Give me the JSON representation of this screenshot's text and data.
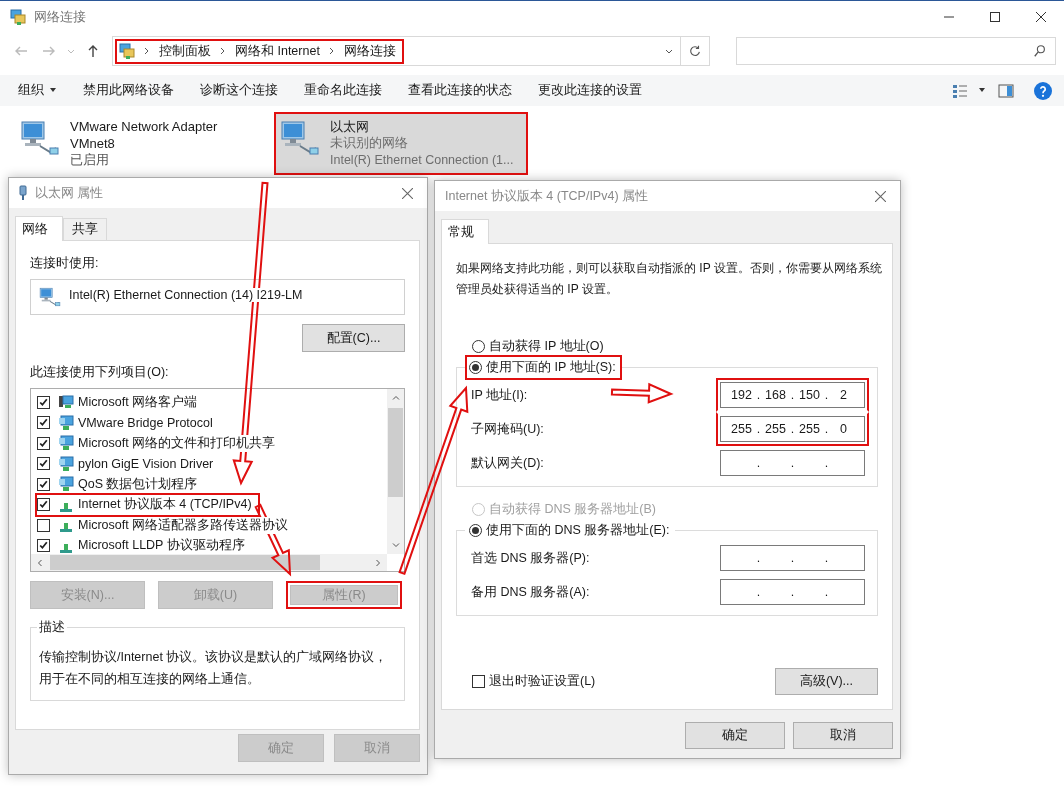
{
  "explorer": {
    "title": "网络连接",
    "breadcrumb": [
      {
        "label": "控制面板"
      },
      {
        "label": "网络和 Internet"
      },
      {
        "label": "网络连接"
      }
    ],
    "breadcrumb_highlighted": true,
    "toolbar": [
      {
        "label": "组织",
        "dropdown": true
      },
      {
        "label": "禁用此网络设备",
        "dropdown": false
      },
      {
        "label": "诊断这个连接",
        "dropdown": false
      },
      {
        "label": "重命名此连接",
        "dropdown": false
      },
      {
        "label": "查看此连接的状态",
        "dropdown": false
      },
      {
        "label": "更改此连接的设置",
        "dropdown": false
      }
    ],
    "connections": [
      {
        "name": "VMware Network Adapter VMnet8",
        "details": [
          "已启用"
        ],
        "selected": false,
        "highlighted": false
      },
      {
        "name": "以太网",
        "details": [
          "未识别的网络",
          "Intel(R) Ethernet Connection (1..."
        ],
        "selected": true,
        "highlighted": true
      }
    ]
  },
  "adapter_properties": {
    "title": "以太网 属性",
    "tabs": [
      {
        "label": "网络",
        "selected": true
      },
      {
        "label": "共享",
        "selected": false
      }
    ],
    "connect_using_label": "连接时使用:",
    "adapter": "Intel(R) Ethernet Connection (14) I219-LM",
    "configure_button": "配置(C)...",
    "items_label": "此连接使用下列项目(O):",
    "items": [
      {
        "label": "Microsoft 网络客户端",
        "checked": true,
        "kind": "client",
        "highlighted": false
      },
      {
        "label": "VMware Bridge Protocol",
        "checked": true,
        "kind": "service",
        "highlighted": false
      },
      {
        "label": "Microsoft 网络的文件和打印机共享",
        "checked": true,
        "kind": "service",
        "highlighted": false
      },
      {
        "label": "pylon GigE Vision Driver",
        "checked": true,
        "kind": "service",
        "highlighted": false
      },
      {
        "label": "QoS 数据包计划程序",
        "checked": true,
        "kind": "service",
        "highlighted": false
      },
      {
        "label": "Internet 协议版本 4 (TCP/IPv4)",
        "checked": true,
        "kind": "protocol",
        "highlighted": true
      },
      {
        "label": "Microsoft 网络适配器多路传送器协议",
        "checked": false,
        "kind": "protocol",
        "highlighted": false
      },
      {
        "label": "Microsoft LLDP 协议驱动程序",
        "checked": true,
        "kind": "protocol",
        "highlighted": false
      }
    ],
    "buttons": [
      {
        "label": "安装(N)...",
        "disabled": true,
        "highlighted": false
      },
      {
        "label": "卸载(U)",
        "disabled": true,
        "highlighted": false
      },
      {
        "label": "属性(R)",
        "disabled": true,
        "highlighted": true
      }
    ],
    "description_title": "描述",
    "description": "传输控制协议/Internet 协议。该协议是默认的广域网络协议，用于在不同的相互连接的网络上通信。",
    "footer_buttons": [
      {
        "label": "确定",
        "disabled": true
      },
      {
        "label": "取消",
        "disabled": true
      }
    ]
  },
  "ipv4_properties": {
    "title": "Internet 协议版本 4 (TCP/IPv4) 属性",
    "tabs": [
      {
        "label": "常规",
        "selected": true
      }
    ],
    "intro": "如果网络支持此功能，则可以获取自动指派的 IP 设置。否则，你需要从网络系统管理员处获得适当的 IP 设置。",
    "separator": ".",
    "ip_options": [
      {
        "label": "自动获得 IP 地址(O)",
        "selected": false,
        "disabled": false,
        "highlighted": false
      },
      {
        "label": "使用下面的 IP 地址(S):",
        "selected": true,
        "disabled": false,
        "highlighted": true
      }
    ],
    "ip_fields": [
      {
        "label": "IP 地址(I):",
        "octets": [
          "192",
          "168",
          "150",
          "2"
        ],
        "highlighted": true
      },
      {
        "label": "子网掩码(U):",
        "octets": [
          "255",
          "255",
          "255",
          "0"
        ],
        "highlighted": true
      },
      {
        "label": "默认网关(D):",
        "highlighted": false
      }
    ],
    "dns_options": [
      {
        "label": "自动获得 DNS 服务器地址(B)",
        "selected": false,
        "disabled": true,
        "highlighted": false
      },
      {
        "label": "使用下面的 DNS 服务器地址(E):",
        "selected": true,
        "disabled": false,
        "highlighted": false
      }
    ],
    "dns_fields": [
      {
        "label": "首选 DNS 服务器(P):"
      },
      {
        "label": "备用 DNS 服务器(A):"
      }
    ],
    "validate": {
      "label": "退出时验证设置(L)",
      "checked": false
    },
    "advanced_button": "高级(V)...",
    "footer_buttons": [
      {
        "label": "确定",
        "disabled": false
      },
      {
        "label": "取消",
        "disabled": false
      }
    ]
  }
}
